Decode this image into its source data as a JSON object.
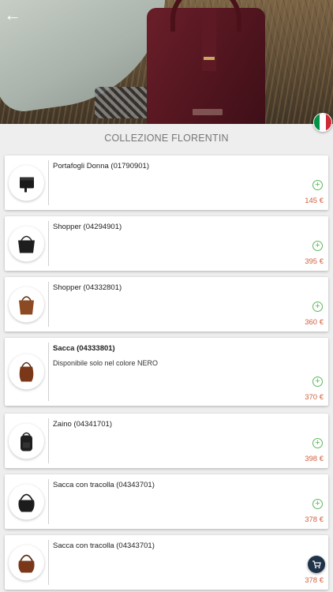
{
  "header": {
    "back_icon": "arrow-left-icon",
    "language_flag": "italy-flag-icon"
  },
  "collection": {
    "title": "COLLEZIONE FLORENTIN"
  },
  "colors": {
    "accent_green": "#5cb85c",
    "price_color": "#d1603d",
    "cart_button": "#1f3349"
  },
  "products": [
    {
      "name": "Portafogli Donna (01790901)",
      "price": "145 €",
      "image": "wallet-icon"
    },
    {
      "name": "Shopper (04294901)",
      "price": "395 €",
      "image": "black-shopper-bag-icon"
    },
    {
      "name": "Shopper (04332801)",
      "price": "360 €",
      "image": "brown-shopper-bag-icon"
    },
    {
      "name": "Sacca (04333801)",
      "note": "Disponibile solo nel colore NERO",
      "price": "370 €",
      "image": "brown-bucket-bag-icon"
    },
    {
      "name": "Zaino (04341701)",
      "price": "398 €",
      "image": "black-backpack-icon"
    },
    {
      "name": "Sacca con tracolla (04343701)",
      "price": "378 €",
      "image": "black-hobo-bag-icon"
    },
    {
      "name": "Sacca con tracolla (04343701)",
      "price": "378 €",
      "image": "brown-hobo-bag-icon"
    }
  ],
  "cart": {
    "icon": "shopping-cart-icon"
  }
}
